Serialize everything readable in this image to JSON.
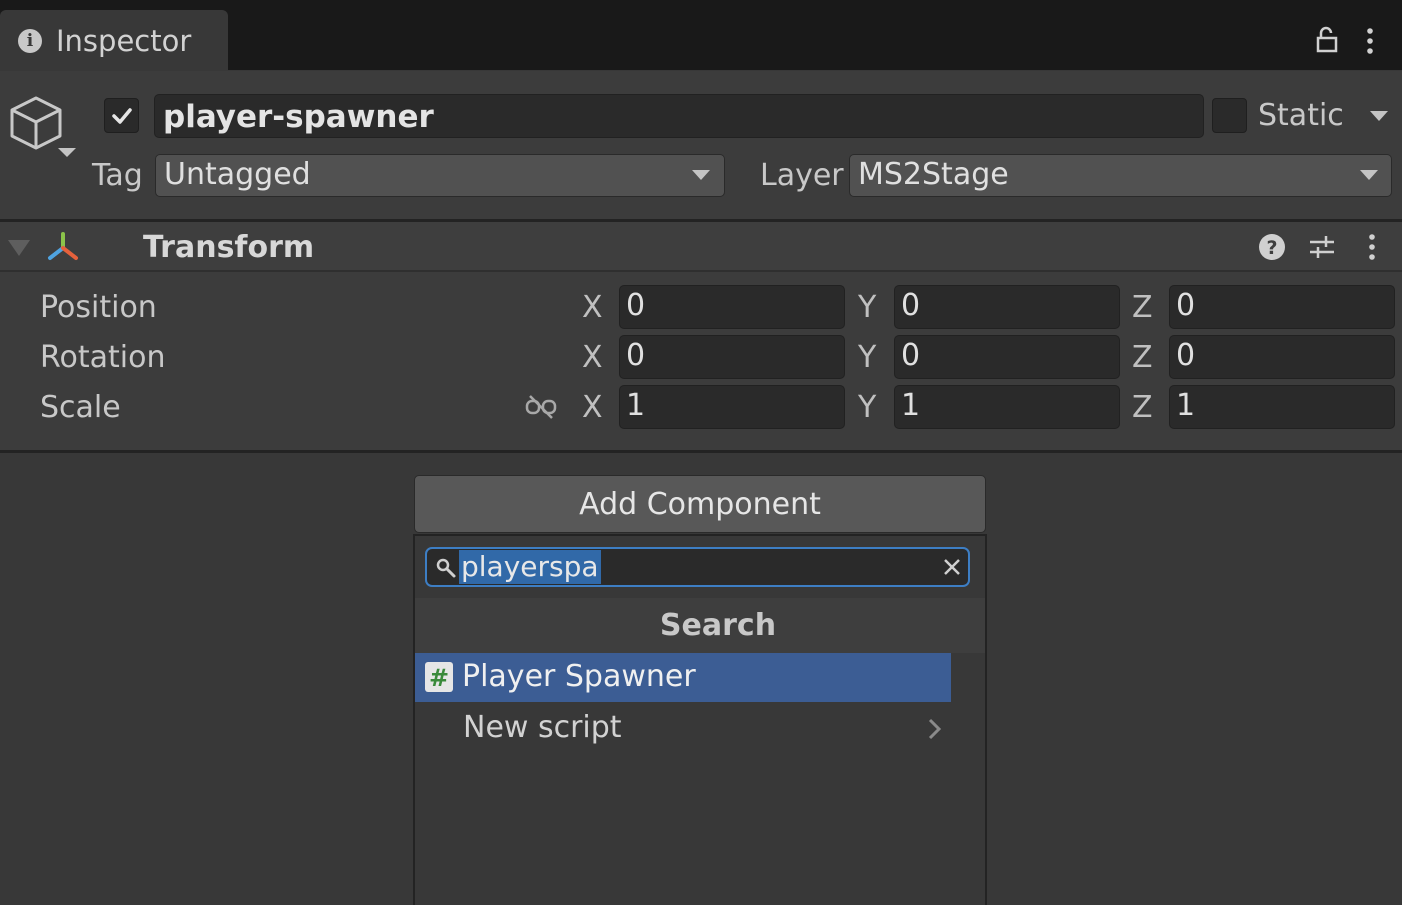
{
  "tab": {
    "label": "Inspector",
    "icon": "info-icon"
  },
  "toolbar": {
    "lock_icon": "lock-icon",
    "menu_icon": "kebab-menu-icon"
  },
  "gameobject": {
    "icon": "cube-icon",
    "active": true,
    "name": "player-spawner",
    "static_label": "Static",
    "static": false,
    "tag_label": "Tag",
    "tag_value": "Untagged",
    "layer_label": "Layer",
    "layer_value": "MS2Stage"
  },
  "transform": {
    "title": "Transform",
    "icons": [
      "transform-icon",
      "help-icon",
      "presets-icon",
      "kebab-menu-icon"
    ],
    "rows": [
      {
        "label": "Position",
        "x": "0",
        "y": "0",
        "z": "0"
      },
      {
        "label": "Rotation",
        "x": "0",
        "y": "0",
        "z": "0"
      },
      {
        "label": "Scale",
        "x": "1",
        "y": "1",
        "z": "1"
      }
    ],
    "axis_labels": {
      "x": "X",
      "y": "Y",
      "z": "Z"
    }
  },
  "add_component": {
    "button_label": "Add Component",
    "search_value": "playerspa",
    "section_heading": "Search",
    "results": [
      {
        "label": "Player Spawner",
        "icon": "script-hash-icon",
        "selected": true
      },
      {
        "label": "New script",
        "icon": "chevron-right-icon",
        "selected": false
      }
    ]
  },
  "colors": {
    "background": "#383838",
    "tab_bar": "#191919",
    "selection": "#3c5d94",
    "search_focus": "#3d7ec4",
    "text_highlight": "#3169a8"
  }
}
